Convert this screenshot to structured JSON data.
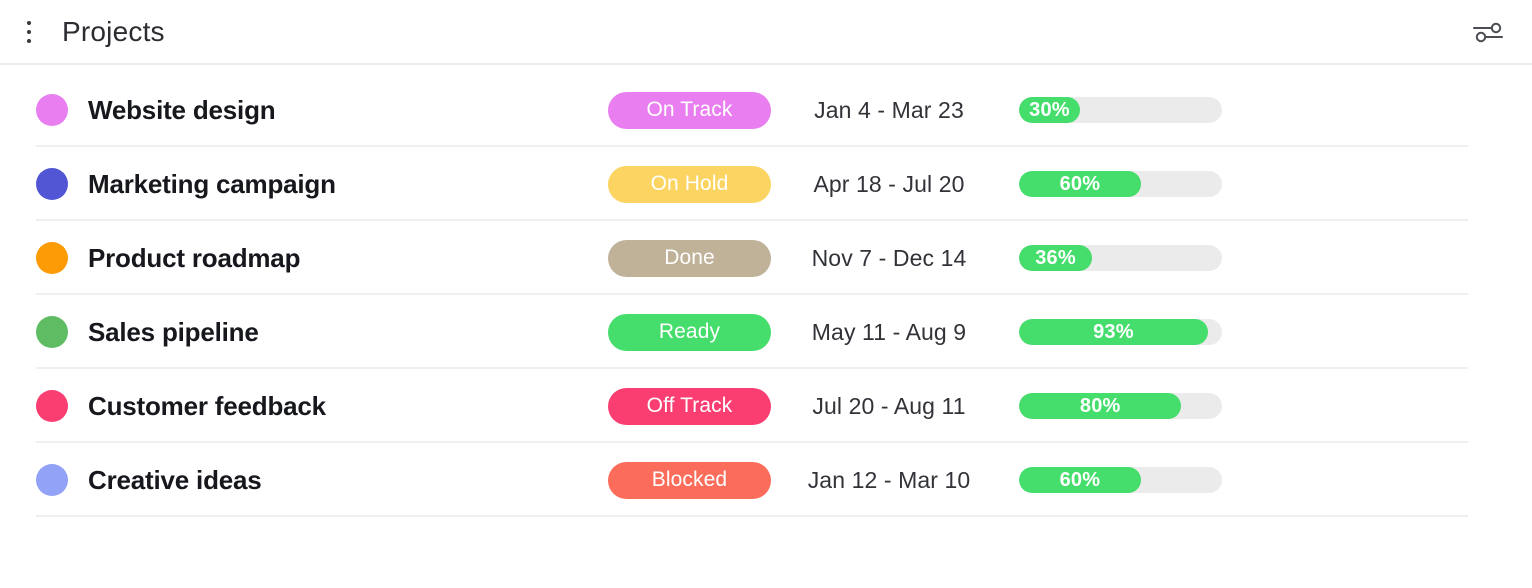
{
  "header": {
    "title": "Projects",
    "menu_icon": "kebab-menu-icon",
    "filter_icon": "sliders-settings-icon"
  },
  "colors": {
    "progress_fill": "#45dd6b",
    "progress_track": "#ebebeb",
    "row_divider": "#efeff1",
    "text_primary": "#16181d"
  },
  "projects": [
    {
      "name": "Website design",
      "dot_color": "#e87ef0",
      "status": "On Track",
      "status_color": "#e87ef0",
      "dates": "Jan 4 - Mar 23",
      "progress": 30,
      "progress_label": "30%"
    },
    {
      "name": "Marketing campaign",
      "dot_color": "#5157d4",
      "status": "On Hold",
      "status_color": "#fbd461",
      "dates": "Apr 18 - Jul 20",
      "progress": 60,
      "progress_label": "60%"
    },
    {
      "name": "Product roadmap",
      "dot_color": "#fd9b07",
      "status": "Done",
      "status_color": "#c0b298",
      "dates": "Nov 7 - Dec 14",
      "progress": 36,
      "progress_label": "36%"
    },
    {
      "name": "Sales pipeline",
      "dot_color": "#5fbc63",
      "status": "Ready",
      "status_color": "#45dd6b",
      "dates": "May 11 - Aug 9",
      "progress": 93,
      "progress_label": "93%"
    },
    {
      "name": "Customer feedback",
      "dot_color": "#fa3e72",
      "status": "Off Track",
      "status_color": "#fa3e72",
      "dates": "Jul 20 - Aug 11",
      "progress": 80,
      "progress_label": "80%"
    },
    {
      "name": "Creative ideas",
      "dot_color": "#92a2f7",
      "status": "Blocked",
      "status_color": "#fb6c5a",
      "dates": "Jan 12 - Mar 10",
      "progress": 60,
      "progress_label": "60%"
    }
  ]
}
